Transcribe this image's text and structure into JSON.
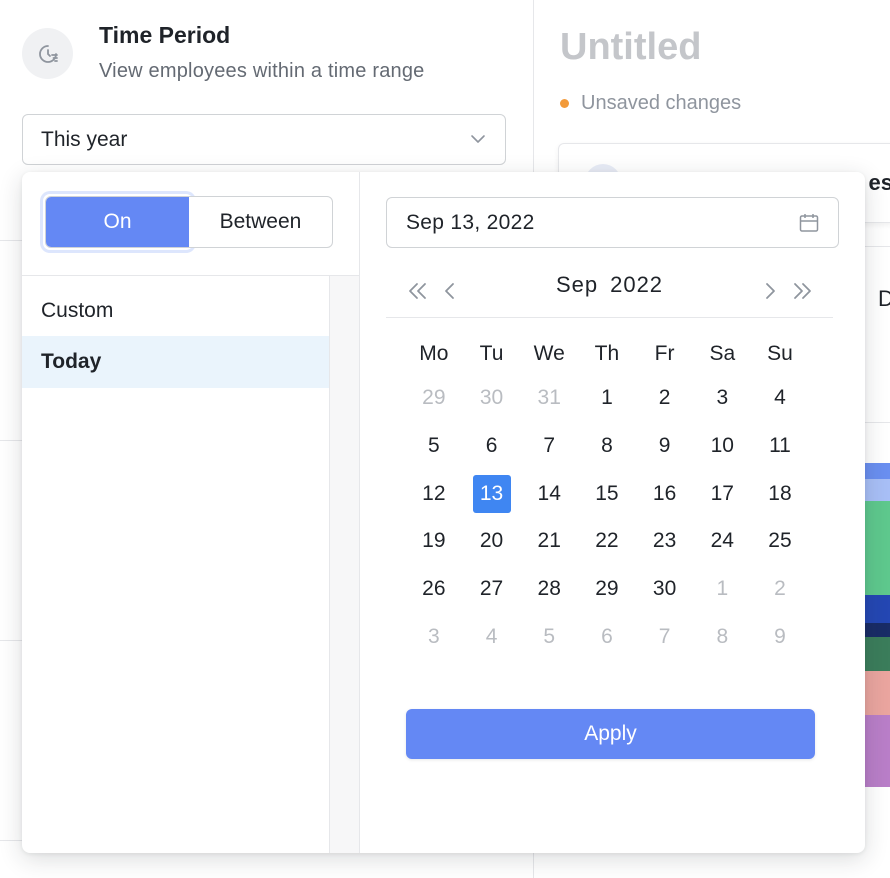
{
  "time_period": {
    "title": "Time Period",
    "subtitle": "View employees within a time range",
    "selected": "This year",
    "icon": "clock-filter-icon"
  },
  "document": {
    "title": "Untitled",
    "status": "Unsaved changes",
    "status_color": "#f29a3a",
    "card_text": "es",
    "side_letter": "D"
  },
  "picker": {
    "mode_on": "On",
    "mode_between": "Between",
    "active_mode": "On",
    "options": [
      {
        "label": "Custom",
        "selected": false
      },
      {
        "label": "Today",
        "selected": true
      }
    ],
    "date_value": "Sep 13, 2022",
    "month": "Sep",
    "year": "2022",
    "weekdays": [
      "Mo",
      "Tu",
      "We",
      "Th",
      "Fr",
      "Sa",
      "Su"
    ],
    "weeks": [
      [
        {
          "d": "29",
          "m": true
        },
        {
          "d": "30",
          "m": true
        },
        {
          "d": "31",
          "m": true
        },
        {
          "d": "1"
        },
        {
          "d": "2"
        },
        {
          "d": "3"
        },
        {
          "d": "4"
        }
      ],
      [
        {
          "d": "5"
        },
        {
          "d": "6"
        },
        {
          "d": "7"
        },
        {
          "d": "8"
        },
        {
          "d": "9"
        },
        {
          "d": "10"
        },
        {
          "d": "11"
        }
      ],
      [
        {
          "d": "12"
        },
        {
          "d": "13",
          "sel": true
        },
        {
          "d": "14"
        },
        {
          "d": "15"
        },
        {
          "d": "16"
        },
        {
          "d": "17"
        },
        {
          "d": "18"
        }
      ],
      [
        {
          "d": "19"
        },
        {
          "d": "20"
        },
        {
          "d": "21"
        },
        {
          "d": "22"
        },
        {
          "d": "23"
        },
        {
          "d": "24"
        },
        {
          "d": "25"
        }
      ],
      [
        {
          "d": "26"
        },
        {
          "d": "27"
        },
        {
          "d": "28"
        },
        {
          "d": "29"
        },
        {
          "d": "30"
        },
        {
          "d": "1",
          "m": true
        },
        {
          "d": "2",
          "m": true
        }
      ],
      [
        {
          "d": "3",
          "m": true
        },
        {
          "d": "4",
          "m": true
        },
        {
          "d": "5",
          "m": true
        },
        {
          "d": "6",
          "m": true
        },
        {
          "d": "7",
          "m": true
        },
        {
          "d": "8",
          "m": true
        },
        {
          "d": "9",
          "m": true
        }
      ]
    ],
    "apply_label": "Apply",
    "accent_color": "#6488f4",
    "selected_day_color": "#3f86f2"
  },
  "bar_colors": [
    "#6a8ff0",
    "#a8bff6",
    "#5ec88d",
    "#2447b3",
    "#192c66",
    "#3b7d5b",
    "#eaa59f",
    "#b97ec8"
  ]
}
